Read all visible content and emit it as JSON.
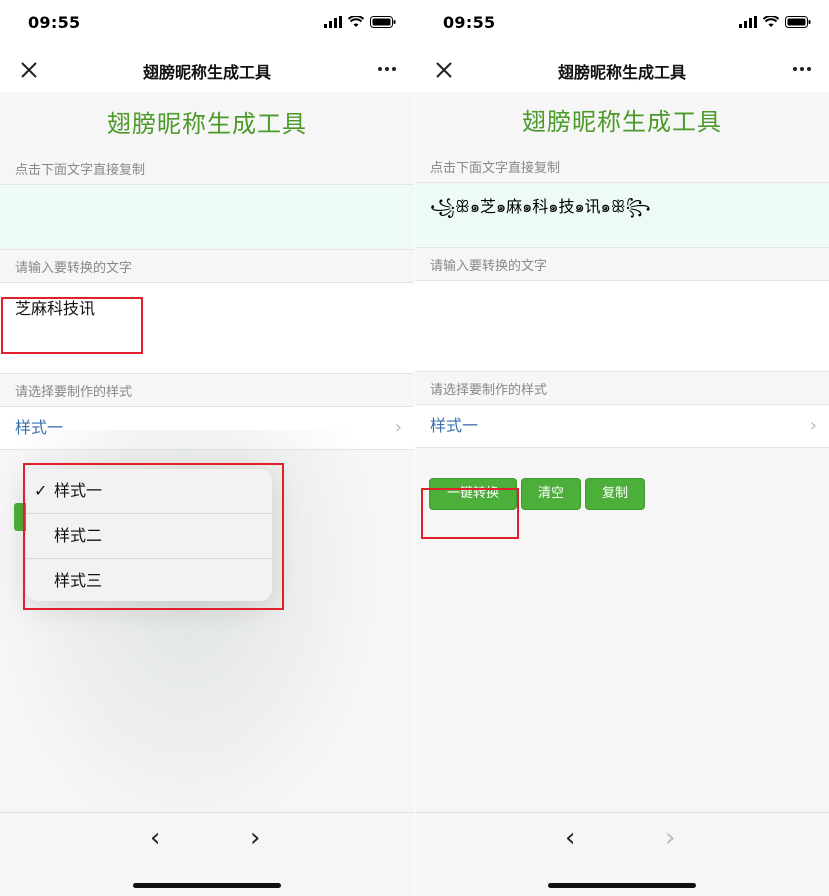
{
  "left": {
    "status": {
      "time": "09:55"
    },
    "nav": {
      "title": "翅膀昵称生成工具"
    },
    "app_title": "翅膀昵称生成工具",
    "output_label": "点击下面文字直接复制",
    "output_text": "",
    "input_label": "请输入要转换的文字",
    "input_value": "芝麻科技讯",
    "style_label": "请选择要制作的样式",
    "selected_style": "样式一",
    "picker": {
      "options": [
        "样式一",
        "样式二",
        "样式三"
      ],
      "checked": "✓"
    }
  },
  "right": {
    "status": {
      "time": "09:55"
    },
    "nav": {
      "title": "翅膀昵称生成工具"
    },
    "app_title": "翅膀昵称生成工具",
    "output_label": "点击下面文字直接复制",
    "output_text": "꧁ꕥ๑芝๑麻๑科๑技๑讯๑ꕥ꧂",
    "input_label": "请输入要转换的文字",
    "input_value": "",
    "style_label": "请选择要制作的样式",
    "selected_style": "样式一",
    "buttons": {
      "convert": "一键转换",
      "clear": "清空",
      "copy": "复制"
    }
  },
  "colors": {
    "accent_green": "#4caf3a",
    "title_green": "#4c9a2a",
    "link_blue": "#3a6fb0",
    "highlight_red": "#e0202b"
  },
  "icons": [
    "signal-icon",
    "wifi-icon",
    "battery-icon",
    "close-icon",
    "more-icon",
    "chevron-right-icon",
    "back-icon",
    "forward-icon",
    "check-icon"
  ]
}
